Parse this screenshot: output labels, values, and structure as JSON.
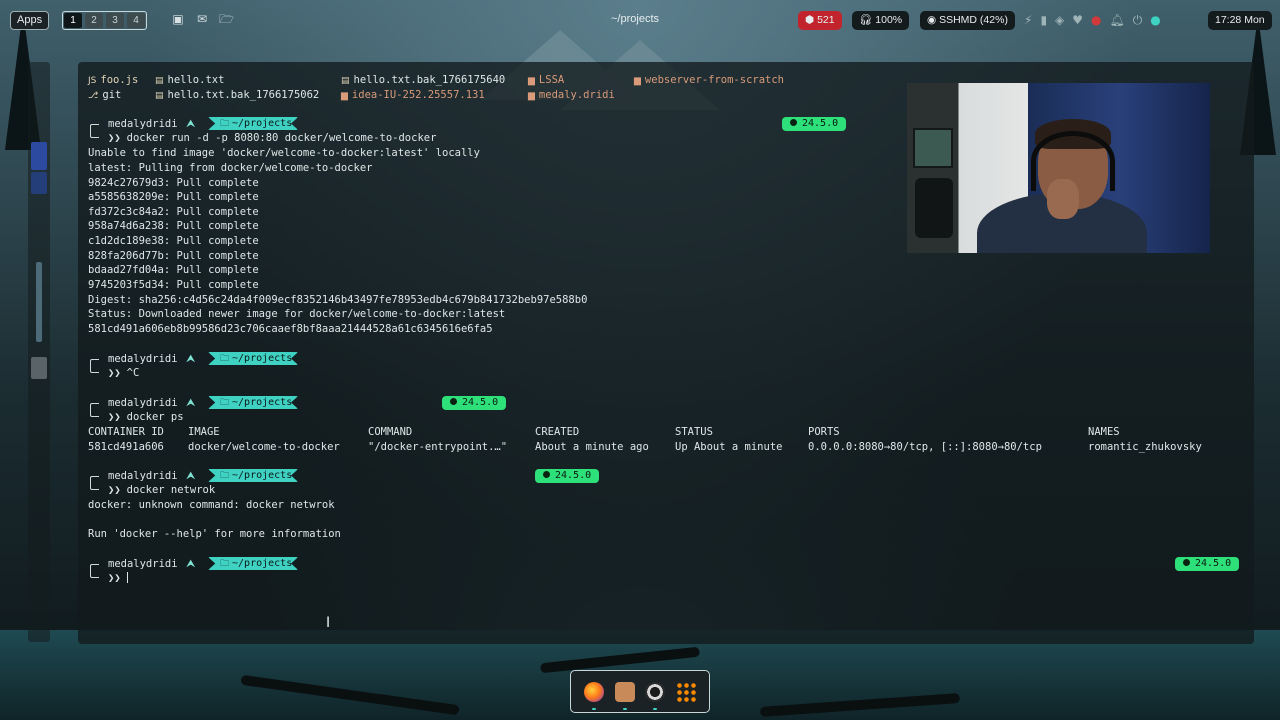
{
  "topbar": {
    "apps_label": "Apps",
    "workspaces": [
      "1",
      "2",
      "3",
      "4"
    ],
    "window_title": "~/projects",
    "notifications_count": "521",
    "volume": "100%",
    "wifi": "SSHMD (42%)",
    "clock": "17:28 Mon"
  },
  "terminal": {
    "ls": [
      {
        "icon": "JS",
        "name": "foo.js",
        "type": "file"
      },
      {
        "icon": "▤",
        "name": "hello.txt",
        "type": "file"
      },
      {
        "icon": "▤",
        "name": "hello.txt.bak_1766175640",
        "type": "file"
      },
      {
        "icon": "▆",
        "name": "LSSA",
        "type": "dir"
      },
      {
        "icon": "▆",
        "name": "webserver-from-scratch",
        "type": "dir"
      },
      {
        "icon": "⎇",
        "name": "git",
        "type": "file"
      },
      {
        "icon": "▤",
        "name": "hello.txt.bak_1766175062",
        "type": "file"
      },
      {
        "icon": "▆",
        "name": "idea-IU-252.25557.131",
        "type": "dir"
      },
      {
        "icon": "▆",
        "name": "medaly.dridi",
        "type": "dir"
      }
    ],
    "prompt": {
      "user": "medalydridi",
      "arch_glyph": "⮝",
      "folder_glyph": "🗀",
      "path": "~/projects",
      "chevron": "❯❯",
      "version": "24.5.0"
    },
    "blocks": {
      "run_cmd": "docker run -d -p 8080:80 docker/welcome-to-docker",
      "run_output": [
        "Unable to find image 'docker/welcome-to-docker:latest' locally",
        "latest: Pulling from docker/welcome-to-docker",
        "9824c27679d3: Pull complete",
        "a5585638209e: Pull complete",
        "fd372c3c84a2: Pull complete",
        "958a74d6a238: Pull complete",
        "c1d2dc189e38: Pull complete",
        "828fa206d77b: Pull complete",
        "bdaad27fd04a: Pull complete",
        "9745203f5d34: Pull complete",
        "Digest: sha256:c4d56c24da4f009ecf8352146b43497fe78953edb4c679b841732beb97e588b0",
        "Status: Downloaded newer image for docker/welcome-to-docker:latest",
        "581cd491a606eb8b99586d23c706caaef8bf8aaa21444528a61c6345616e6fa5"
      ],
      "ctrl_c_cmd": "^C",
      "ps_cmd": "docker ps",
      "ps_headers": [
        "CONTAINER ID",
        "IMAGE",
        "COMMAND",
        "CREATED",
        "STATUS",
        "PORTS",
        "NAMES"
      ],
      "ps_row": [
        "581cd491a606",
        "docker/welcome-to-docker",
        "\"/docker-entrypoint.…\"",
        "About a minute ago",
        "Up About a minute",
        "0.0.0.0:8080→80/tcp, [::]:8080→80/tcp",
        "romantic_zhukovsky"
      ],
      "netwrok_cmd": "docker netwrok",
      "netwrok_output": [
        "docker: unknown command: docker netwrok",
        "",
        "Run 'docker --help' for more information"
      ]
    }
  },
  "colors": {
    "accent_teal": "#3fd1c1",
    "version_green": "#2ee07a",
    "dir_orange": "#d99b7a",
    "notif_red": "#c2242d"
  }
}
